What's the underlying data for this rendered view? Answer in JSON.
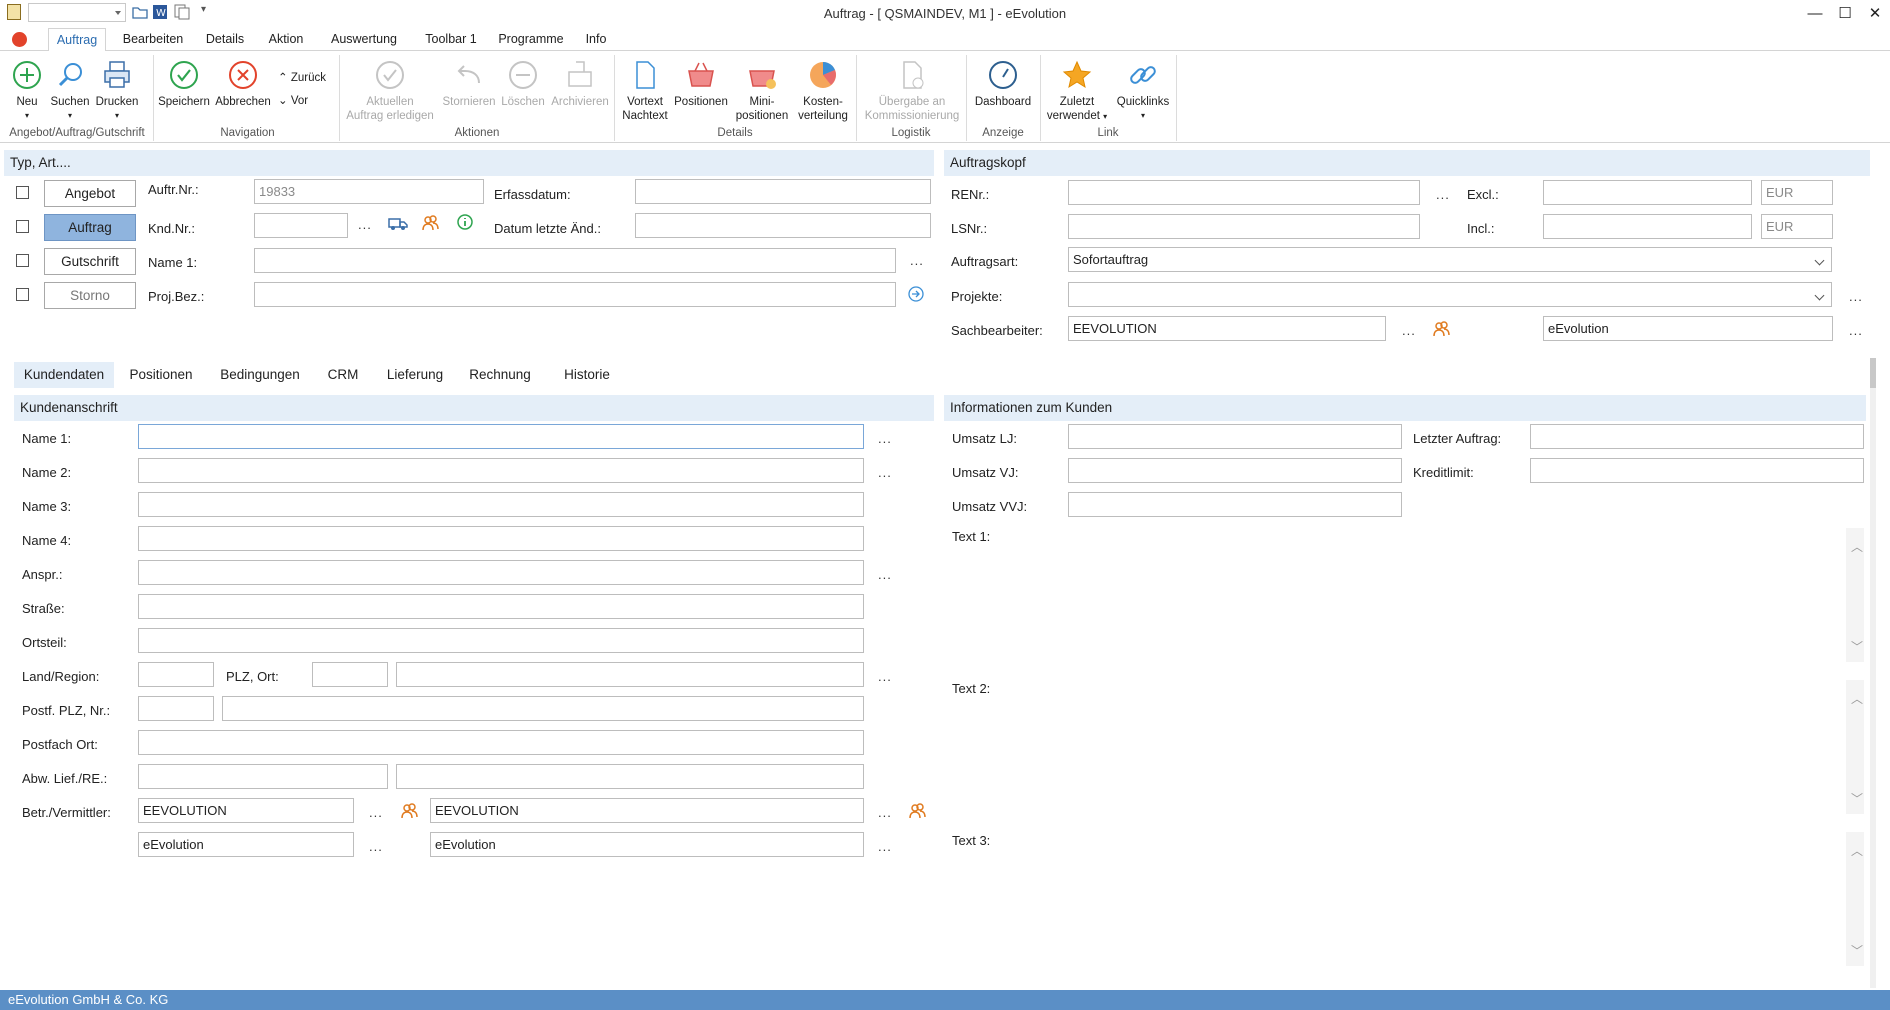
{
  "window": {
    "title": "Auftrag - [ QSMAINDEV, M1 ]  -  eEvolution"
  },
  "menu": {
    "tabs": [
      "Auftrag",
      "Bearbeiten",
      "Details",
      "Aktion",
      "Auswertung",
      "Toolbar 1",
      "Programme",
      "Info"
    ]
  },
  "ribbon": {
    "neu": "Neu",
    "suchen": "Suchen",
    "drucken": "Drucken",
    "speichern": "Speichern",
    "abbrechen": "Abbrechen",
    "zurueck": "Zurück",
    "vor": "Vor",
    "aktuellen_l1": "Aktuellen",
    "aktuellen_l2": "Auftrag erledigen",
    "stornieren": "Stornieren",
    "loeschen": "Löschen",
    "archivieren": "Archivieren",
    "vortext_l1": "Vortext",
    "vortext_l2": "Nachtext",
    "positionen": "Positionen",
    "mini_l1": "Mini-",
    "mini_l2": "positionen",
    "kosten_l1": "Kosten-",
    "kosten_l2": "verteilung",
    "uebergabe_l1": "Übergabe an",
    "uebergabe_l2": "Kommissionierung",
    "dashboard": "Dashboard",
    "zuletzt_l1": "Zuletzt",
    "zuletzt_l2": "verwendet",
    "quicklinks": "Quicklinks",
    "groups": {
      "angebot": "Angebot/Auftrag/Gutschrift",
      "navigation": "Navigation",
      "aktionen": "Aktionen",
      "details": "Details",
      "logistik": "Logistik",
      "anzeige": "Anzeige",
      "link": "Link"
    }
  },
  "typ": {
    "header": "Typ, Art....",
    "buttons": [
      "Angebot",
      "Auftrag",
      "Gutschrift",
      "Storno"
    ],
    "auftr_nr_label": "Auftr.Nr.:",
    "auftr_nr_value": "19833",
    "knd_nr_label": "Knd.Nr.:",
    "name1_label": "Name 1:",
    "projbez_label": "Proj.Bez.:",
    "erfassdatum_label": "Erfassdatum:",
    "datum_label": "Datum letzte Änd.:",
    "dots": "..."
  },
  "auftragskopf": {
    "header": "Auftragskopf",
    "renr_label": "RENr.:",
    "lsnr_label": "LSNr.:",
    "excl_label": "Excl.:",
    "incl_label": "Incl.:",
    "currency": "EUR",
    "auftragsart_label": "Auftragsart:",
    "auftragsart_value": "Sofortauftrag",
    "projekte_label": "Projekte:",
    "sachbearbeiter_label": "Sachbearbeiter:",
    "sachbearbeiter_value": "EEVOLUTION",
    "sachbearbeiter_name": "eEvolution"
  },
  "tabs": [
    "Kundendaten",
    "Positionen",
    "Bedingungen",
    "CRM",
    "Lieferung",
    "Rechnung",
    "Historie"
  ],
  "kundenanschrift": {
    "header": "Kundenanschrift",
    "labels": [
      "Name 1:",
      "Name 2:",
      "Name 3:",
      "Name 4:",
      "Anspr.:",
      "Straße:",
      "Ortsteil:",
      "Land/Region:",
      "Postf. PLZ, Nr.:",
      "Postfach Ort:",
      "Abw. Lief./RE.:",
      "Betr./Vermittler:"
    ],
    "plz_ort_label": "PLZ, Ort:",
    "betr_1": "EEVOLUTION",
    "betr_2": "EEVOLUTION",
    "betr_3": "eEvolution",
    "betr_4": "eEvolution"
  },
  "kundeninfo": {
    "header": "Informationen zum Kunden",
    "umsatz_lj": "Umsatz LJ:",
    "umsatz_vj": "Umsatz VJ:",
    "umsatz_vvj": "Umsatz VVJ:",
    "letzter_auftrag": "Letzter Auftrag:",
    "kreditlimit": "Kreditlimit:",
    "text1": "Text 1:",
    "text2": "Text 2:",
    "text3": "Text 3:"
  },
  "status": {
    "company": "eEvolution GmbH & Co. KG"
  },
  "colors": {
    "accent": "#2b6cb0",
    "selected": "#8fb4de",
    "section": "#e4eef8",
    "statusbar": "#5b8fc6"
  }
}
